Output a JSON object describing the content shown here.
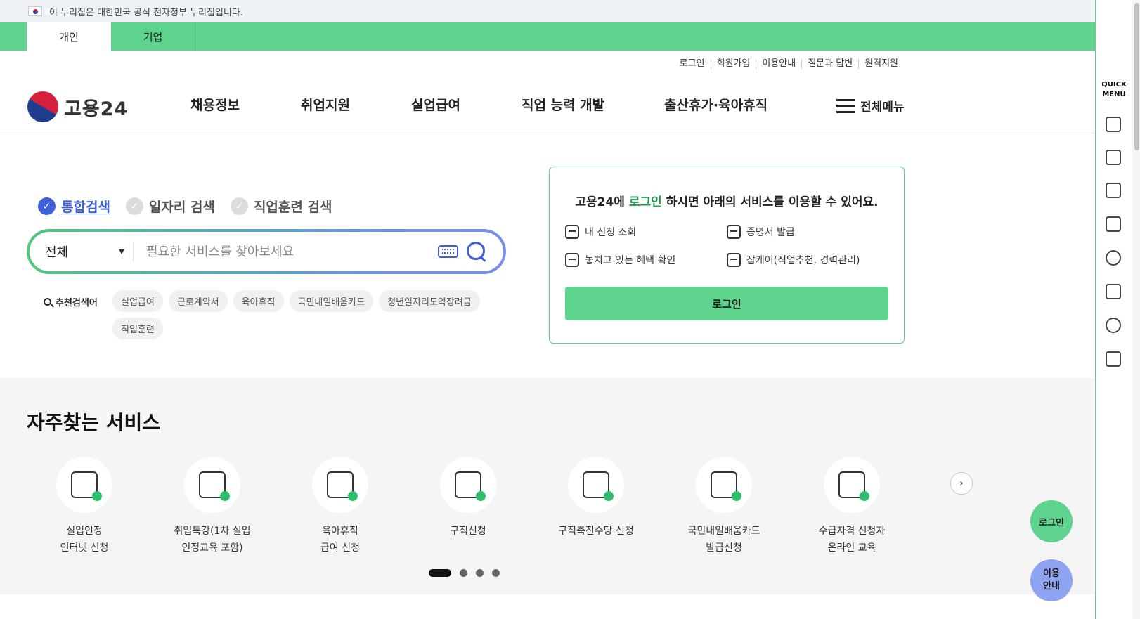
{
  "gov_banner": {
    "text": "이 누리집은 대한민국 공식 전자정부 누리집입니다."
  },
  "tabs": [
    {
      "label": "개인",
      "active": true
    },
    {
      "label": "기업",
      "active": false
    }
  ],
  "util_links": [
    "로그인",
    "회원가입",
    "이용안내",
    "질문과 답변",
    "원격지원"
  ],
  "logo": {
    "text": "고용24"
  },
  "gnb": [
    "채용정보",
    "취업지원",
    "실업급여",
    "직업 능력 개발",
    "출산휴가·육아휴직"
  ],
  "all_menu": {
    "label": "전체메뉴"
  },
  "search": {
    "tabs": [
      "통합검색",
      "일자리 검색",
      "직업훈련 검색"
    ],
    "active_tab": "통합검색",
    "select_value": "전체",
    "placeholder": "필요한 서비스를 찾아보세요",
    "recommend_label": "추천검색어",
    "keywords": [
      "실업급여",
      "근로계약서",
      "육아휴직",
      "국민내일배움카드",
      "청년일자리도약장려금",
      "직업훈련"
    ]
  },
  "login_box": {
    "title_prefix": "고용24에 ",
    "title_highlight": "로그인",
    "title_suffix": " 하시면 아래의 서비스를 이용할 수 있어요.",
    "services": [
      "내 신청 조회",
      "증명서 발급",
      "놓치고 있는 혜택 확인",
      "잡케어(직업추천, 경력관리)"
    ],
    "button": "로그인"
  },
  "frequent": {
    "title": "자주찾는 서비스",
    "items": [
      "실업인정\n인터넷 신청",
      "취업특강(1차 실업\n인정교육 포함)",
      "육아휴직\n급여 신청",
      "구직신청",
      "구직촉진수당 신청",
      "국민내일배움카드\n발급신청",
      "수급자격 신청자\n온라인 교육"
    ],
    "pages": 4,
    "current_page": 1
  },
  "quick_menu": {
    "title": "QUICK MENU",
    "icons": [
      "building-icon",
      "chat-icon",
      "monitor-icon",
      "checklist-icon",
      "smile-icon",
      "calculator-icon",
      "coin-icon",
      "printer-icon"
    ]
  },
  "floating": {
    "login": "로그인",
    "guide": "이용\n안내"
  },
  "colors": {
    "brand_green": "#5ed38d",
    "accent_blue": "#3f5fd8"
  }
}
